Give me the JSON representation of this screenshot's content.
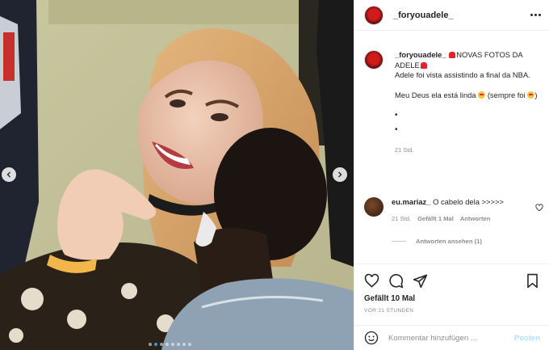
{
  "post": {
    "username": "_foryouadele_",
    "caption": {
      "username": "_foryouadele_",
      "line1": "NOVAS FOTOS DA ADELE",
      "line2": "Adele foi vista assistindo a final da NBA.",
      "line3_a": "Meu Deus ela está linda",
      "line3_b": "(sempre foi",
      "line3_c": ")",
      "dot1": "•",
      "dot2": "•",
      "time": "21 Std."
    },
    "comment": {
      "username": "eu.mariaz_",
      "text": "O cabelo dela >>>>>",
      "time": "21 Std.",
      "likes": "Gefällt 1 Mal",
      "reply": "Antworten"
    },
    "view_replies": "Antworten ansehen (1)",
    "likes": "Gefällt 10 Mal",
    "posted": "VOR 21 STUNDEN",
    "add_comment_placeholder": "Kommentar hinzufügen ...",
    "post_button": "Posten"
  },
  "carousel": {
    "slide_count": 8,
    "active_index": 1
  },
  "icons": {
    "options": "more-horizontal-icon",
    "like": "heart-icon",
    "comment": "comment-bubble-icon",
    "share": "paper-plane-icon",
    "save": "bookmark-icon",
    "emoji": "smiley-icon",
    "prev": "chevron-left-icon",
    "next": "chevron-right-icon"
  },
  "colors": {
    "link_blue": "#3897f0",
    "post_disabled": "#b2dffc",
    "text_primary": "#262626",
    "text_secondary": "#8e8e8e"
  }
}
